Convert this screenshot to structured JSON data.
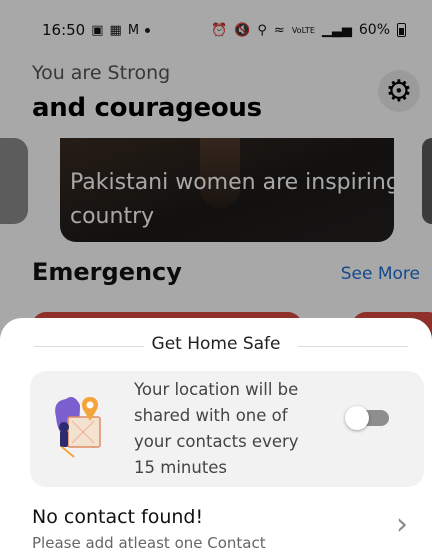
{
  "status_bar": {
    "time": "16:50",
    "battery": "60%",
    "left_icons": [
      "gallery-icon",
      "sim-icon",
      "gmail-icon",
      "dot-icon"
    ],
    "right_icons": [
      "alarm-icon",
      "mute-icon",
      "location-icon",
      "wifi-icon",
      "volte-icon",
      "signal-icon",
      "battery-icon"
    ],
    "volte_label": "VoLTE"
  },
  "header": {
    "subtitle": "You are Strong",
    "title": "and courageous",
    "settings_icon": "gear-icon"
  },
  "carousel": {
    "card_text": "Pakistani women are inspiring country"
  },
  "emergency": {
    "title": "Emergency",
    "see_more": "See More"
  },
  "sheet": {
    "title": "Get Home Safe",
    "info_text": "Your location will be shared with one of your contacts every 15 minutes",
    "toggle_on": false,
    "contact_title": "No contact found!",
    "contact_subtitle": "Please add atleast one Contact"
  },
  "colors": {
    "link": "#1d6fd6",
    "emergency_card": "#d94a42",
    "scrim": "rgba(0,0,0,0.34)",
    "toggle_track": "#8e8e8e"
  }
}
